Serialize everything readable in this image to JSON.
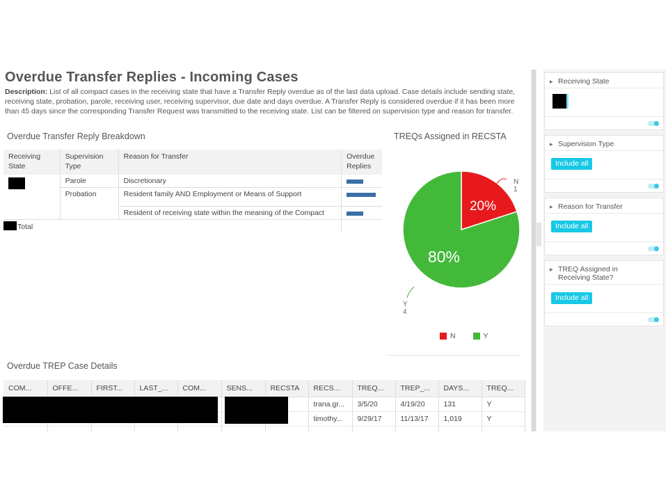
{
  "page": {
    "title": "Overdue Transfer Replies - Incoming Cases",
    "description_label": "Description:",
    "description_text": " List of all compact cases in the receiving state that have a Transfer Reply overdue as of the last data upload. Case details include sending state, receiving state, probation, parole, receiving user, receiving supervisor, due date and days overdue. A Transfer Reply is considered overdue if it has been more than 45 days since the corresponding Transfer Request was transmitted to the receiving state. List can be filtered on supervision type and reason for transfer."
  },
  "breakdown": {
    "title": "Overdue Transfer Reply Breakdown",
    "headers": [
      "Receiving State",
      "Supervision Type",
      "Reason for Transfer",
      "Overdue Replies"
    ],
    "rows": [
      {
        "supervision": "Parole",
        "reason": "Discretionary",
        "bar": 0.55
      },
      {
        "supervision": "Probation",
        "reason": "Resident family AND Employment or Means of Support",
        "bar": 0.95
      },
      {
        "supervision": "",
        "reason": "Resident of receiving state within the meaning of the Compact",
        "bar": 0.55
      }
    ],
    "total_label": "Total",
    "bar_color": "#3a6ea5"
  },
  "pie": {
    "title": "TREQs Assigned in RECSTA",
    "slices": [
      {
        "label": "N",
        "count": "1",
        "percent": "20%",
        "color": "#e8191c"
      },
      {
        "label": "Y",
        "count": "4",
        "percent": "80%",
        "color": "#43b93a"
      }
    ],
    "legend": [
      "N",
      "Y"
    ]
  },
  "details": {
    "title": "Overdue TREP Case Details",
    "headers": [
      "COM...",
      "OFFE...",
      "FIRST...",
      "LAST_...",
      "COM...",
      "SENS...",
      "RECSTA",
      "RECS...",
      "TREQ...",
      "TREP_...",
      "DAYS...",
      "TREQ..."
    ],
    "rows": [
      [
        "",
        "",
        "",
        "",
        "",
        "",
        "",
        "trana.gr...",
        "3/5/20",
        "4/19/20",
        "131",
        "Y"
      ],
      [
        "",
        "",
        "",
        "",
        "",
        "",
        "",
        "timothy...",
        "9/29/17",
        "11/13/17",
        "1,019",
        "Y"
      ]
    ]
  },
  "filters": [
    {
      "label": "Receiving State",
      "button": ""
    },
    {
      "label": "Supervision Type",
      "button": "Include all"
    },
    {
      "label": "Reason for Transfer",
      "button": "Include all"
    },
    {
      "label": "TREQ Assigned in Receiving State?",
      "button": "Include all"
    }
  ],
  "icons": {
    "filter_expand": "chevron-right-icon",
    "filter_toggle": "toggle-switch-icon"
  },
  "colors": {
    "accent": "#19c8e6",
    "bar": "#3a6ea5",
    "pie_n": "#e8191c",
    "pie_y": "#43b93a"
  }
}
